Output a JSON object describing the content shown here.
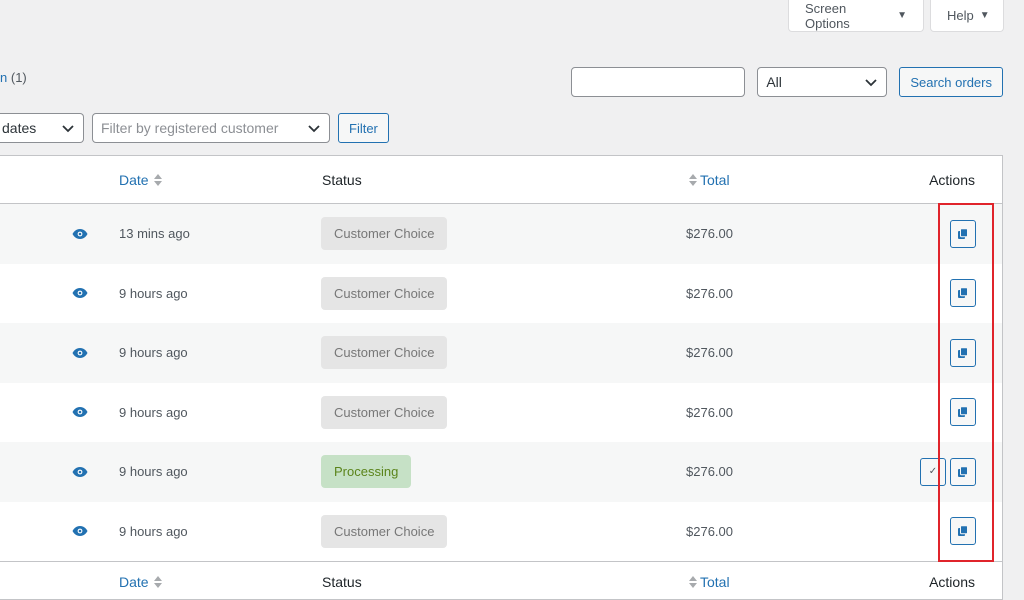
{
  "screen_meta": {
    "screen_options_label": "Screen Options",
    "help_label": "Help"
  },
  "views": {
    "partial_link": "n",
    "count": "(1)"
  },
  "search": {
    "value": "",
    "status_filter": "All",
    "button_label": "Search orders"
  },
  "filters": {
    "date_value": "dates",
    "customer_placeholder": "Filter by registered customer",
    "filter_button_label": "Filter"
  },
  "table": {
    "columns": {
      "date": "Date",
      "status": "Status",
      "total": "Total",
      "actions": "Actions"
    },
    "rows": [
      {
        "date": "13 mins ago",
        "status": "Customer Choice",
        "total": "$276.00"
      },
      {
        "date": "9 hours ago",
        "status": "Customer Choice",
        "total": "$276.00"
      },
      {
        "date": "9 hours ago",
        "status": "Customer Choice",
        "total": "$276.00"
      },
      {
        "date": "9 hours ago",
        "status": "Customer Choice",
        "total": "$276.00"
      },
      {
        "date": "9 hours ago",
        "status": "Processing",
        "total": "$276.00"
      },
      {
        "date": "9 hours ago",
        "status": "Customer Choice",
        "total": "$276.00"
      }
    ]
  },
  "colors": {
    "accent": "#2271b1",
    "highlight": "#e0242b",
    "processing_bg": "#c6e1c6",
    "processing_text": "#5b841b",
    "choice_bg": "#e5e5e5"
  },
  "icons": {
    "preview": "eye-icon",
    "duplicate": "copy-icon",
    "complete": "checkmark-icon",
    "sort": "sort-arrows-icon",
    "dropdown": "chevron-down-icon"
  }
}
